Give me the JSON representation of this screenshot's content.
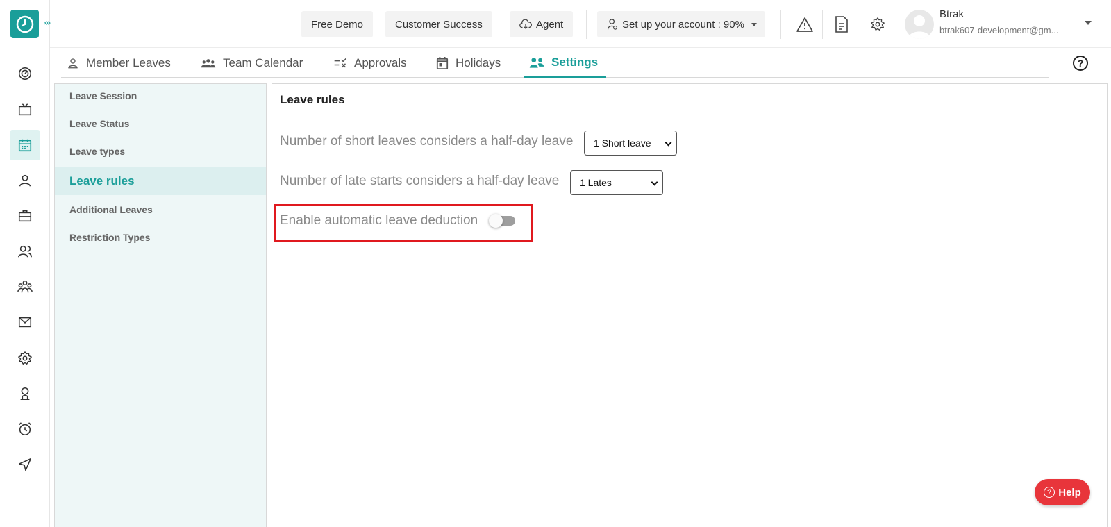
{
  "header": {
    "free_demo": "Free Demo",
    "customer_success": "Customer Success",
    "agent": "Agent",
    "setup": "Set up your account : 90%",
    "user_name": "Btrak",
    "user_email": "btrak607-development@gm..."
  },
  "tabs": [
    {
      "label": "Member Leaves",
      "icon": "person-icon"
    },
    {
      "label": "Team Calendar",
      "icon": "team-icon"
    },
    {
      "label": "Approvals",
      "icon": "approvals-icon"
    },
    {
      "label": "Holidays",
      "icon": "calendar-icon"
    },
    {
      "label": "Settings",
      "icon": "settings-people-icon",
      "active": true
    }
  ],
  "sidemenu": {
    "items": [
      {
        "label": "Leave Session"
      },
      {
        "label": "Leave Status"
      },
      {
        "label": "Leave types"
      },
      {
        "label": "Leave rules",
        "active": true
      },
      {
        "label": "Additional Leaves"
      },
      {
        "label": "Restriction Types"
      }
    ]
  },
  "main": {
    "title": "Leave rules",
    "short_leaves_label": "Number of short leaves considers a half-day leave",
    "short_leaves_value": "1 Short leave",
    "late_starts_label": "Number of late starts considers a half-day leave",
    "late_starts_value": "1 Lates",
    "auto_deduction_label": "Enable automatic leave deduction",
    "auto_deduction_enabled": false
  },
  "help": {
    "label": "Help"
  },
  "colors": {
    "accent": "#1a9e99",
    "highlight": "#e0191f",
    "help": "#e8353b"
  }
}
